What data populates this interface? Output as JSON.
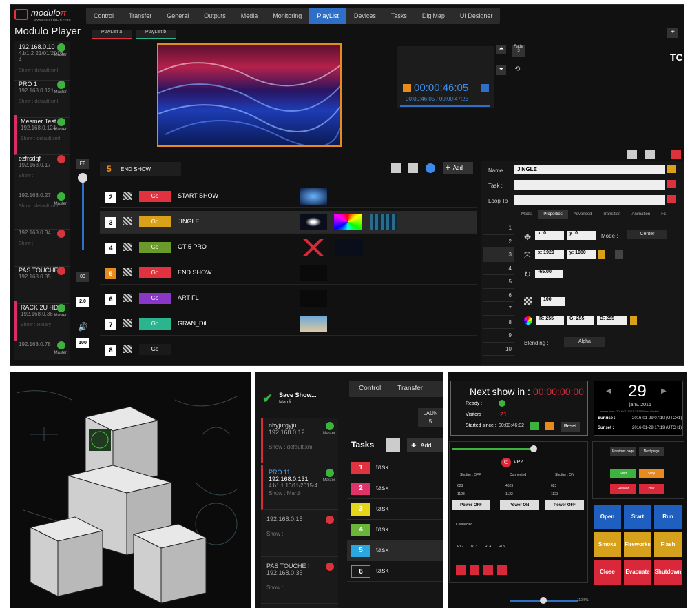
{
  "app": {
    "brand": "modulo",
    "brand_pi": "π",
    "url": "www.modulo-pi.com",
    "title": "Modulo Player"
  },
  "nav": [
    "Control",
    "Transfer",
    "General",
    "Outputs",
    "Media",
    "Monitoring",
    "PlayList",
    "Devices",
    "Tasks",
    "DigiMap",
    "UI Designer"
  ],
  "nav_active": "PlayList",
  "playlist_tabs": [
    "PlayList a",
    "PlayList b"
  ],
  "servers": [
    {
      "name": "192.168.0.10",
      "ip": "4.b1.2 21/01/2016-4",
      "show": "Show : default.xml",
      "status": "ok",
      "master": "Master"
    },
    {
      "name": "PRO 1",
      "ip": "192.168.0.121",
      "show": "Show : default.xml",
      "status": "ok",
      "master": "Master"
    },
    {
      "name": "Mesmer Test",
      "ip": "192.168.0.124",
      "show": "Show : default.xml",
      "status": "ok",
      "master": "Master"
    },
    {
      "name": "ezfrsdqf",
      "ip": "192.168.0.17",
      "show": "Show :",
      "status": "err",
      "master": ""
    },
    {
      "name": "",
      "ip": "192.168.0.27",
      "show": "Show : default.xml",
      "status": "ok",
      "master": "Master"
    },
    {
      "name": "",
      "ip": "192.168.0.34",
      "show": "Show :",
      "status": "err",
      "master": ""
    },
    {
      "name": "PAS TOUCHE !",
      "ip": "192.168.0.35",
      "show": "",
      "status": "err",
      "master": ""
    },
    {
      "name": "RACK 2U HDMI",
      "ip": "192.168.0.36",
      "show": "Show : Rotary",
      "status": "ok",
      "master": "Master"
    },
    {
      "name": "",
      "ip": "192.168.0.78",
      "show": "",
      "status": "ok",
      "master": "Master"
    }
  ],
  "transport": {
    "timecode": "00:00:46:05",
    "sub": "00:00:46:05 / 00:00:47:23",
    "fade": "Fade",
    "fade_val": "3",
    "tc": "TC",
    "ff": "FF",
    "oo": "00",
    "ratio": "2.0",
    "vol": "100"
  },
  "cue_header": {
    "num": "5",
    "name": "END SHOW",
    "add": "Add"
  },
  "cues": [
    {
      "num": "2",
      "go": "Go",
      "name": "START SHOW",
      "color": "#e0333f"
    },
    {
      "num": "3",
      "go": "Go",
      "name": "JINGLE",
      "color": "#d9a11a"
    },
    {
      "num": "4",
      "go": "Go",
      "name": "GT 5 PRO",
      "color": "#6a9a2a"
    },
    {
      "num": "5",
      "go": "Go",
      "name": "END SHOW",
      "color": "#e0333f"
    },
    {
      "num": "6",
      "go": "Go",
      "name": "ART FL",
      "color": "#8a36c7"
    },
    {
      "num": "7",
      "go": "Go",
      "name": "GRAN_Dil",
      "color": "#2ab58e"
    },
    {
      "num": "8",
      "go": "Go",
      "name": "",
      "color": "#1a1a1a"
    }
  ],
  "props": {
    "name_label": "Name :",
    "name_value": "JINGLE",
    "task_label": "Task :",
    "loop_label": "Loop To :",
    "tabs": [
      "Media",
      "Properties",
      "Advanced",
      "Transition",
      "Animation",
      "Fx"
    ],
    "x": "0",
    "y": "0",
    "mode_label": "Mode :",
    "mode": "Center",
    "w": "1920",
    "h": "1080",
    "rot": "-65.00",
    "opacity": "100",
    "r": "255",
    "g": "255",
    "b": "255",
    "blend_label": "Blending :",
    "blend": "Alpha",
    "layers": [
      "1",
      "2",
      "3",
      "4",
      "5",
      "6",
      "7",
      "8",
      "9",
      "10"
    ]
  },
  "p2": {
    "save": "Save Show...",
    "save_sub": "Mardi",
    "tabs": [
      "Control",
      "Transfer"
    ],
    "launch": "LAUN",
    "launch_n": "5",
    "servers": [
      {
        "name": "nhyjutgyju",
        "ip": "192.168.0.12",
        "extra": "",
        "show": "Show : default.xml",
        "status": "ok",
        "master": "Master"
      },
      {
        "name": "PRO 11",
        "ip": "192.168.0.131",
        "extra": "4.b1.1 10/11/2015-4",
        "show": "Show : Mardi",
        "status": "ok",
        "master": "Master"
      },
      {
        "name": "",
        "ip": "192.168.0.15",
        "extra": "",
        "show": "Show :",
        "status": "err",
        "master": ""
      },
      {
        "name": "PAS TOUCHE !",
        "ip": "192.168.0.35",
        "extra": "",
        "show": "Show :",
        "status": "err",
        "master": ""
      }
    ],
    "tasks_title": "Tasks",
    "add": "Add",
    "tasks": [
      {
        "n": "1",
        "l": "task",
        "c": "#e0333f"
      },
      {
        "n": "2",
        "l": "task",
        "c": "#e0336a"
      },
      {
        "n": "3",
        "l": "task",
        "c": "#e6d61a"
      },
      {
        "n": "4",
        "l": "task",
        "c": "#6ab63a"
      },
      {
        "n": "5",
        "l": "task",
        "c": "#2aa7e0"
      },
      {
        "n": "6",
        "l": "task",
        "c": "#1a1a1a"
      }
    ]
  },
  "p3": {
    "next": "Next show in :",
    "next_tc": "00:00:00:00",
    "ready": "Ready :",
    "visitors": "Visitors :",
    "visitors_n": "21",
    "started": "Started since :",
    "started_tc": "00:03:46:02",
    "reset": "Reset",
    "day": "29",
    "month": "janv. 2016",
    "server_time": "server time : 2016-01-29 11:23:56 Paris, Madrid",
    "sunrise": "Sunrise :",
    "sunrise_v": "2016-01-29 07:10 (UTC+1)",
    "sunset": "Sunset :",
    "sunset_v": "2016-01-29 17:19 (UTC+1)",
    "vp": "VP2",
    "shutter_off": "Shutter : OFF",
    "connected": "Connected",
    "shutter_on": "Shutter : ON",
    "lamps": [
      [
        "623",
        "1123"
      ],
      [
        "4623",
        "1122"
      ],
      [
        "623",
        "1123"
      ]
    ],
    "power": [
      "Power OFF",
      "Power ON",
      "Power OFF"
    ],
    "relays": [
      "RL2",
      "RL3",
      "RL4",
      "RL5"
    ],
    "prev": "Previous page",
    "nextp": "Next page",
    "start": "Start",
    "stop": "Stop",
    "reboot": "Reboot",
    "halt": "Halt",
    "tiles": [
      {
        "l": "Open",
        "c": "#1f5fbf"
      },
      {
        "l": "Start",
        "c": "#1f5fbf"
      },
      {
        "l": "Run",
        "c": "#1f5fbf"
      },
      {
        "l": "Smoke",
        "c": "#d6a21e"
      },
      {
        "l": "Fireworks",
        "c": "#d6a21e"
      },
      {
        "l": "Flash",
        "c": "#d6a21e"
      },
      {
        "l": "Close",
        "c": "#d9283a"
      },
      {
        "l": "Evacuate",
        "c": "#d9283a"
      },
      {
        "l": "Shutdown",
        "c": "#d9283a"
      }
    ],
    "zoom": "110.5%"
  }
}
